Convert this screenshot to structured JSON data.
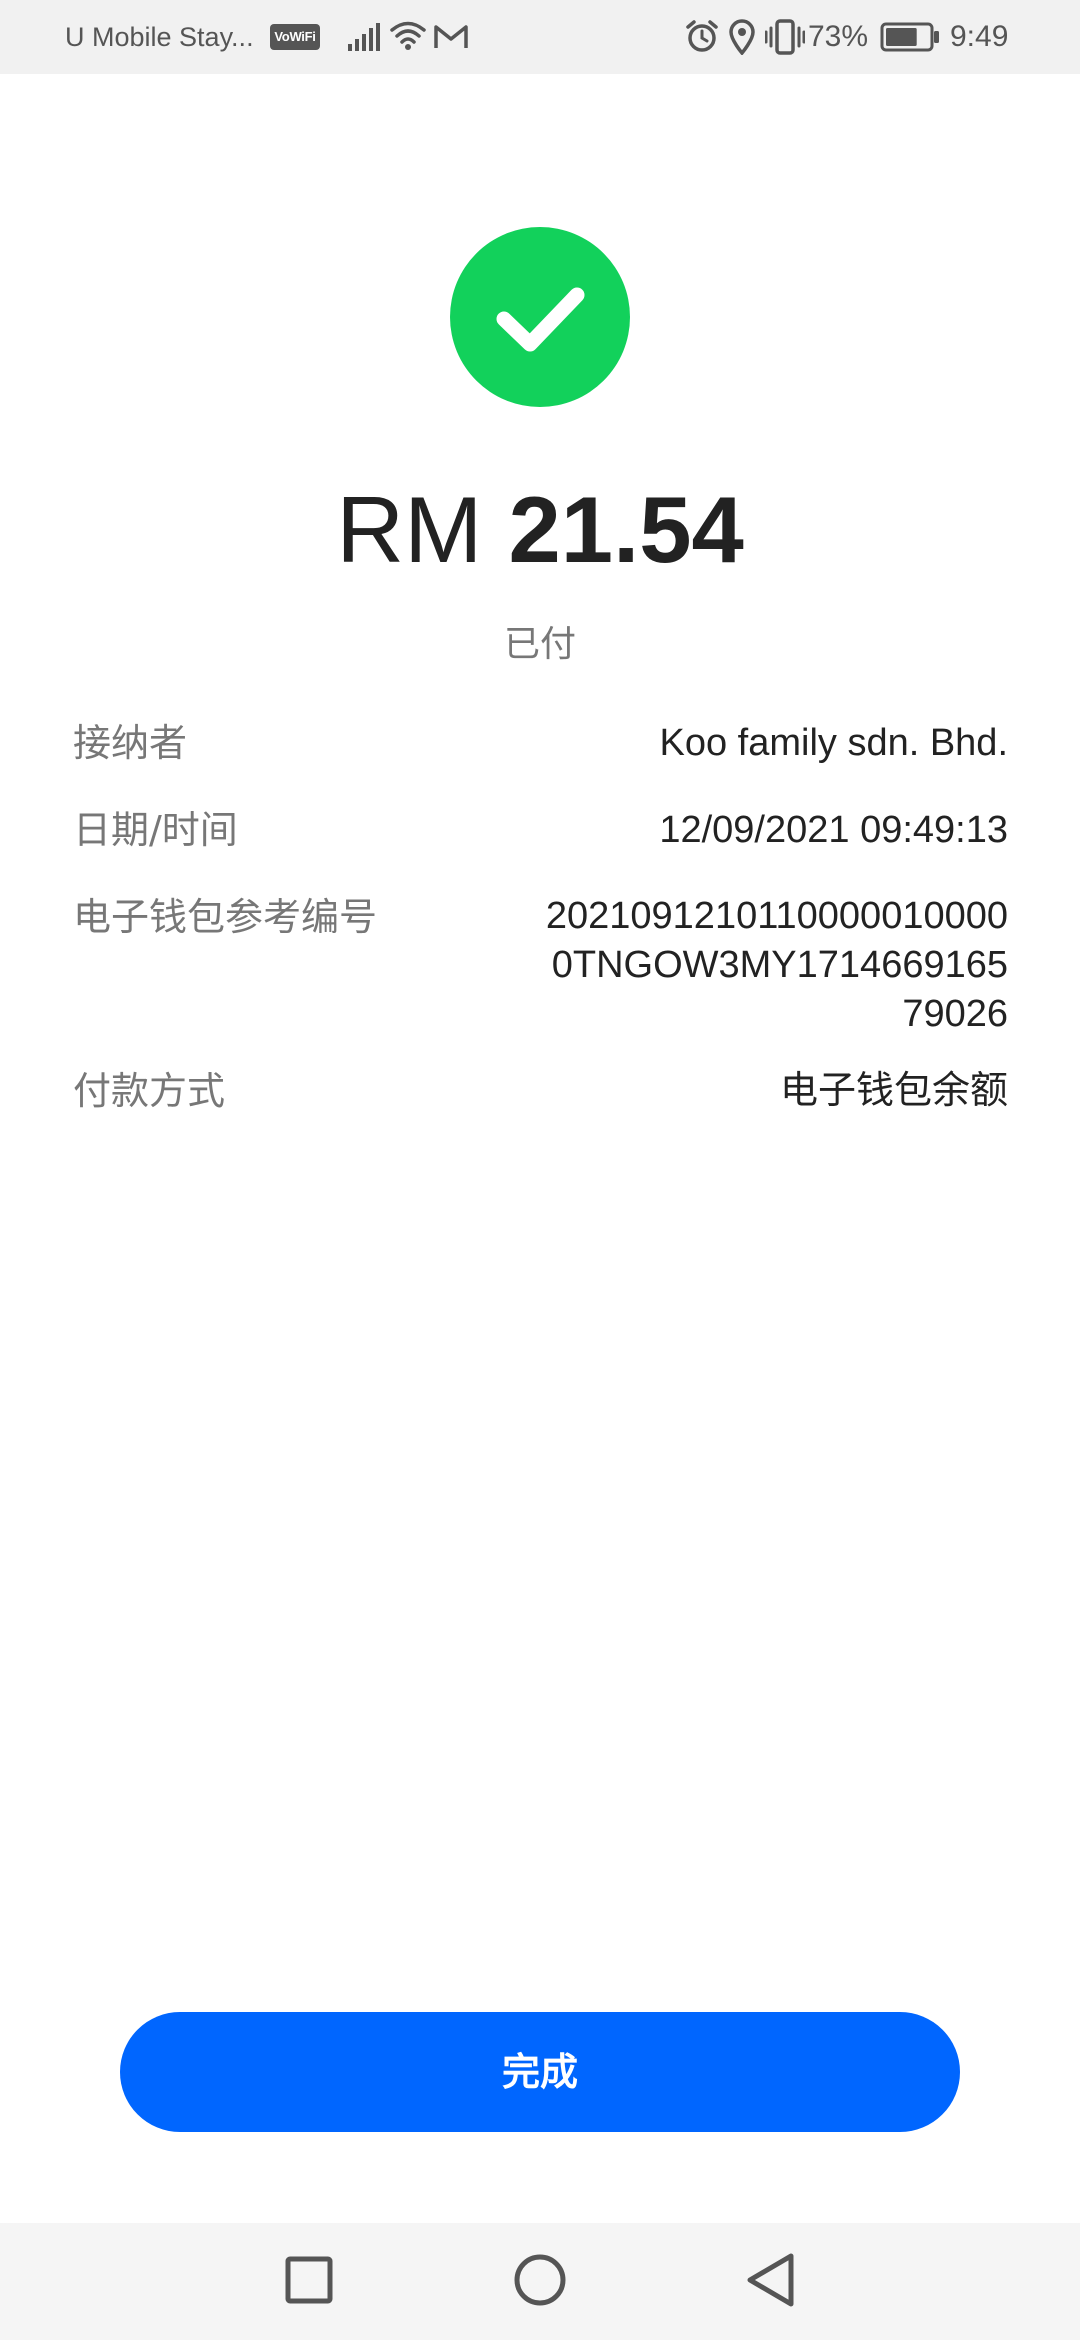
{
  "status_bar": {
    "carrier": "U Mobile Stay...",
    "vowifi_label": "VoWiFi",
    "battery_percent": "73%",
    "time": "9:49",
    "icons": [
      "signal-icon",
      "wifi-icon",
      "gmail-icon",
      "alarm-icon",
      "location-icon",
      "vibrate-icon",
      "battery-icon"
    ],
    "battery_level": 0.73
  },
  "success": {
    "icon": "checkmark-icon",
    "color": "#12d15b"
  },
  "payment": {
    "currency": "RM",
    "amount": "21.54",
    "status": "已付"
  },
  "details": {
    "recipient": {
      "label": "接纳者",
      "value": "Koo family sdn. Bhd."
    },
    "datetime": {
      "label": "日期/时间",
      "value": "12/09/2021 09:49:13"
    },
    "ewallet_ref": {
      "label": "电子钱包参考编号",
      "value": "20210912101100000100000TNGOW3MY171466916579026"
    },
    "payment_method": {
      "label": "付款方式",
      "value": "电子钱包余额"
    }
  },
  "done_button": {
    "label": "完成",
    "color": "#0066ff"
  },
  "nav_bar": {
    "icons": [
      "recents-square-icon",
      "home-circle-icon",
      "back-triangle-icon"
    ]
  }
}
